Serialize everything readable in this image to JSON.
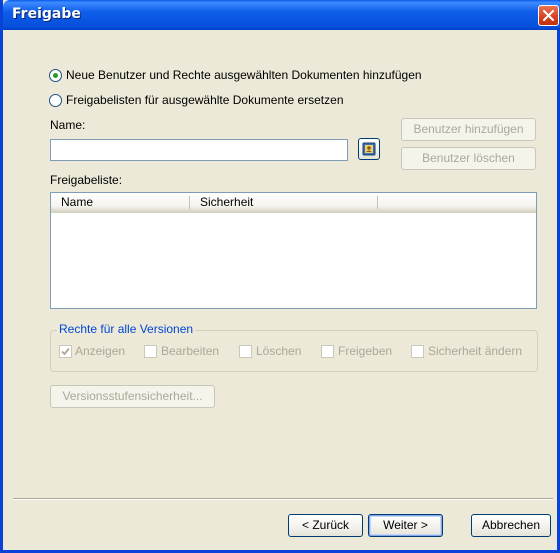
{
  "window": {
    "title": "Freigabe"
  },
  "options": {
    "add_rights": "Neue Benutzer und Rechte ausgewählten Dokumenten hinzufügen",
    "replace_lists": "Freigabelisten für ausgewählte Dokumente ersetzen",
    "selected": "add_rights"
  },
  "name": {
    "label": "Name:",
    "value": ""
  },
  "buttons": {
    "add_user": "Benutzer hinzufügen",
    "delete_user": "Benutzer löschen",
    "version_security": "Versionsstufensicherheit...",
    "back": "< Zurück",
    "next": "Weiter >",
    "cancel": "Abbrechen"
  },
  "share_list": {
    "label": "Freigabeliste:",
    "columns": [
      "Name",
      "Sicherheit"
    ],
    "rows": []
  },
  "rights": {
    "title": "Rechte für alle Versionen",
    "items": [
      {
        "label": "Anzeigen",
        "checked": true
      },
      {
        "label": "Bearbeiten",
        "checked": false
      },
      {
        "label": "Löschen",
        "checked": false
      },
      {
        "label": "Freigeben",
        "checked": false
      },
      {
        "label": "Sicherheit ändern",
        "checked": false
      }
    ]
  },
  "icons": {
    "close": "close-icon",
    "address_book": "address-book-icon"
  },
  "colors": {
    "titlebar": "#0a5ae8",
    "group_title": "#0046d5",
    "radio_dot": "#21a121"
  }
}
